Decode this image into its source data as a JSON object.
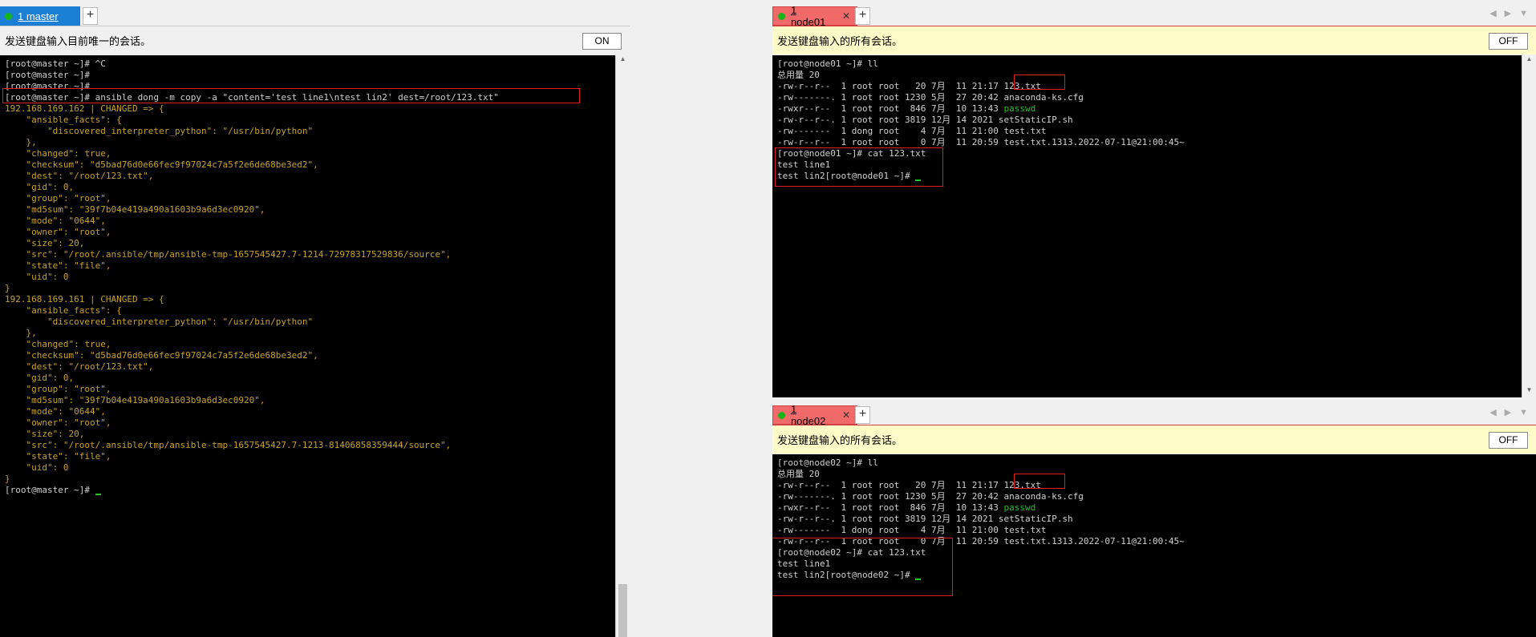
{
  "master": {
    "tab_label": "1 master",
    "plus": "+",
    "send_text": "发送键盘输入目前唯一的会话。",
    "toggle": "ON",
    "lines": [
      {
        "t": "[root@master ~]# ^C",
        "c": "w"
      },
      {
        "t": "[root@master ~]#",
        "c": "w"
      },
      {
        "t": "[root@master ~]#",
        "c": "w"
      },
      {
        "t": "[root@master ~]# ansible dong -m copy -a \"content='test line1\\ntest lin2' dest=/root/123.txt\"",
        "c": "w"
      },
      {
        "t": "192.168.169.162 | CHANGED => {",
        "c": "y"
      },
      {
        "t": "    \"ansible_facts\": {",
        "c": "y"
      },
      {
        "t": "        \"discovered_interpreter_python\": \"/usr/bin/python\"",
        "c": "y"
      },
      {
        "t": "    },",
        "c": "y"
      },
      {
        "t": "    \"changed\": true,",
        "c": "y"
      },
      {
        "t": "    \"checksum\": \"d5bad76d0e66fec9f97024c7a5f2e6de68be3ed2\",",
        "c": "y"
      },
      {
        "t": "    \"dest\": \"/root/123.txt\",",
        "c": "y"
      },
      {
        "t": "    \"gid\": 0,",
        "c": "y"
      },
      {
        "t": "    \"group\": \"root\",",
        "c": "y"
      },
      {
        "t": "    \"md5sum\": \"39f7b04e419a490a1603b9a6d3ec0920\",",
        "c": "y"
      },
      {
        "t": "    \"mode\": \"0644\",",
        "c": "y"
      },
      {
        "t": "    \"owner\": \"root\",",
        "c": "y"
      },
      {
        "t": "    \"size\": 20,",
        "c": "y"
      },
      {
        "t": "    \"src\": \"/root/.ansible/tmp/ansible-tmp-1657545427.7-1214-72978317529836/source\",",
        "c": "y"
      },
      {
        "t": "    \"state\": \"file\",",
        "c": "y"
      },
      {
        "t": "    \"uid\": 0",
        "c": "y"
      },
      {
        "t": "}",
        "c": "y"
      },
      {
        "t": "192.168.169.161 | CHANGED => {",
        "c": "y"
      },
      {
        "t": "    \"ansible_facts\": {",
        "c": "y"
      },
      {
        "t": "        \"discovered_interpreter_python\": \"/usr/bin/python\"",
        "c": "y"
      },
      {
        "t": "    },",
        "c": "y"
      },
      {
        "t": "    \"changed\": true,",
        "c": "y"
      },
      {
        "t": "    \"checksum\": \"d5bad76d0e66fec9f97024c7a5f2e6de68be3ed2\",",
        "c": "y"
      },
      {
        "t": "    \"dest\": \"/root/123.txt\",",
        "c": "y"
      },
      {
        "t": "    \"gid\": 0,",
        "c": "y"
      },
      {
        "t": "    \"group\": \"root\",",
        "c": "y"
      },
      {
        "t": "    \"md5sum\": \"39f7b04e419a490a1603b9a6d3ec0920\",",
        "c": "y"
      },
      {
        "t": "    \"mode\": \"0644\",",
        "c": "y"
      },
      {
        "t": "    \"owner\": \"root\",",
        "c": "y"
      },
      {
        "t": "    \"size\": 20,",
        "c": "y"
      },
      {
        "t": "    \"src\": \"/root/.ansible/tmp/ansible-tmp-1657545427.7-1213-81406858359444/source\",",
        "c": "y"
      },
      {
        "t": "    \"state\": \"file\",",
        "c": "y"
      },
      {
        "t": "    \"uid\": 0",
        "c": "y"
      },
      {
        "t": "}",
        "c": "y"
      },
      {
        "t": "[root@master ~]# ",
        "c": "w",
        "cursor": true
      }
    ]
  },
  "node01": {
    "tab_label": "1 node01",
    "plus": "+",
    "send_text": "发送键盘输入的所有会话。",
    "toggle": "OFF",
    "lines": [
      {
        "t": "[root@node01 ~]# ll",
        "c": "w"
      },
      {
        "t": "总用量 20",
        "c": "w"
      },
      {
        "t": "-rw-r--r--  1 root root   20 7月  11 21:17 ",
        "c": "w",
        "tail": "123.txt",
        "tc": "w"
      },
      {
        "t": "-rw-------. 1 root root 1230 5月  27 20:42 anaconda-ks.cfg",
        "c": "w"
      },
      {
        "t": "-rwxr--r--  1 root root  846 7月  10 13:43 ",
        "c": "w",
        "tail": "passwd",
        "tc": "g"
      },
      {
        "t": "-rw-r--r--. 1 root root 3819 12月 14 2021 setStaticIP.sh",
        "c": "w"
      },
      {
        "t": "-rw-------  1 dong root    4 7月  11 21:00 test.txt",
        "c": "w"
      },
      {
        "t": "-rw-r--r--  1 root root    0 7月  11 20:59 test.txt.1313.2022-07-11@21:00:45~",
        "c": "w"
      },
      {
        "t": "[root@node01 ~]# cat 123.txt",
        "c": "w"
      },
      {
        "t": "test line1",
        "c": "w"
      },
      {
        "t": "test lin2[root@node01 ~]# ",
        "c": "w",
        "cursor": true
      }
    ]
  },
  "node02": {
    "tab_label": "1 node02",
    "plus": "+",
    "send_text": "发送键盘输入的所有会话。",
    "toggle": "OFF",
    "lines": [
      {
        "t": "[root@node02 ~]# ll",
        "c": "w"
      },
      {
        "t": "总用量 20",
        "c": "w"
      },
      {
        "t": "-rw-r--r--  1 root root   20 7月  11 21:17 ",
        "c": "w",
        "tail": "123.txt",
        "tc": "w"
      },
      {
        "t": "-rw-------. 1 root root 1230 5月  27 20:42 anaconda-ks.cfg",
        "c": "w"
      },
      {
        "t": "-rwxr--r--  1 root root  846 7月  10 13:43 ",
        "c": "w",
        "tail": "passwd",
        "tc": "g"
      },
      {
        "t": "-rw-r--r--. 1 root root 3819 12月 14 2021 setStaticIP.sh",
        "c": "w"
      },
      {
        "t": "-rw-------  1 dong root    4 7月  11 21:00 test.txt",
        "c": "w"
      },
      {
        "t": "-rw-r--r--  1 root root    0 7月  11 20:59 test.txt.1313.2022-07-11@21:00:45~",
        "c": "w"
      },
      {
        "t": "[root@node02 ~]# cat 123.txt",
        "c": "w"
      },
      {
        "t": "test line1",
        "c": "w"
      },
      {
        "t": "test lin2[root@node02 ~]# ",
        "c": "w",
        "cursor": true
      }
    ]
  },
  "colors": {
    "master_tab": "#1c7fd6",
    "node_tab": "#f06a6a",
    "send_bar_master": "#f0f0f0",
    "send_bar_node": "#fffbc8",
    "output_yellow": "#c9a227",
    "output_white": "#cfcfcf",
    "file_green": "#20c020",
    "highlight_red": "#e02020",
    "status_green": "#19b419"
  }
}
